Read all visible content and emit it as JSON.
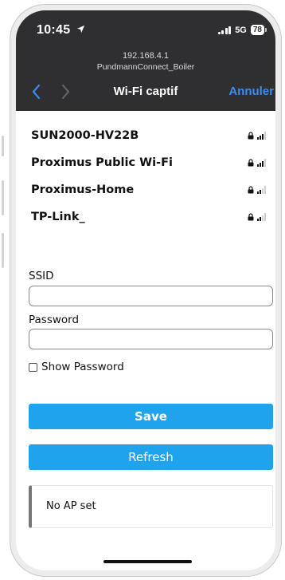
{
  "status_bar": {
    "time": "10:45",
    "network_type": "5G",
    "battery": "78"
  },
  "browser": {
    "host": "192.168.4.1",
    "subtitle": "PundmannConnect_Boiler",
    "title": "Wi-Fi captif",
    "cancel_label": "Annuler"
  },
  "networks": [
    {
      "name": "SUN2000-HV22B",
      "secured": true,
      "signal_bars": 3
    },
    {
      "name": "Proximus Public Wi-Fi",
      "secured": true,
      "signal_bars": 3
    },
    {
      "name": "Proximus-Home",
      "secured": true,
      "signal_bars": 2
    },
    {
      "name": "TP-Link_",
      "secured": true,
      "signal_bars": 2
    }
  ],
  "form": {
    "ssid_label": "SSID",
    "ssid_value": "",
    "password_label": "Password",
    "password_value": "",
    "show_password_label": "Show Password",
    "save_label": "Save",
    "refresh_label": "Refresh"
  },
  "message": {
    "text": "No AP set"
  },
  "colors": {
    "button": "#1fa3ec",
    "header_bg": "#2f2f31",
    "link_blue": "#3d8bf2"
  }
}
